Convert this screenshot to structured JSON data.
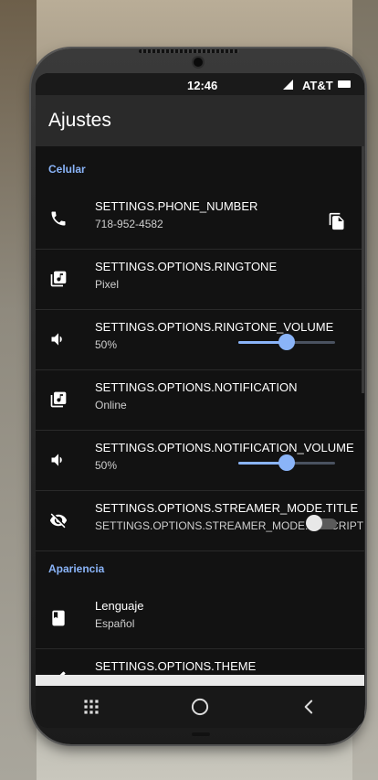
{
  "status_bar": {
    "time": "12:46",
    "carrier": "AT&T"
  },
  "app_bar": {
    "title": "Ajustes"
  },
  "sections": [
    {
      "label": "Celular"
    },
    {
      "label": "Apariencia"
    }
  ],
  "rows": {
    "phone": {
      "title": "SETTINGS.PHONE_NUMBER",
      "value": "718-952-4582",
      "icon": "phone-icon",
      "action_icon": "copy-icon"
    },
    "ringtone": {
      "title": "SETTINGS.OPTIONS.RINGTONE",
      "value": "Pixel",
      "icon": "music-note-icon"
    },
    "ringtone_volume": {
      "title": "SETTINGS.OPTIONS.RINGTONE_VOLUME",
      "value": "50%",
      "icon": "speaker-icon",
      "level": 0.5
    },
    "notification": {
      "title": "SETTINGS.OPTIONS.NOTIFICATION",
      "value": "Online",
      "icon": "music-note-icon"
    },
    "notification_volume": {
      "title": "SETTINGS.OPTIONS.NOTIFICATION_VOLUME",
      "value": "50%",
      "icon": "speaker-icon",
      "level": 0.5
    },
    "streamer_mode": {
      "title": "SETTINGS.OPTIONS.STREAMER_MODE.TITLE",
      "value": "SETTINGS.OPTIONS.STREAMER_MODE.DESCRIPTION",
      "icon": "eye-off-icon",
      "enabled": false
    },
    "language": {
      "title": "Lenguaje",
      "value": "Español",
      "icon": "book-icon"
    },
    "theme": {
      "title": "SETTINGS.OPTIONS.THEME",
      "icon": "brush-icon"
    }
  },
  "nav_bar": {
    "icons": [
      "recent-apps-icon",
      "home-icon",
      "back-icon"
    ]
  },
  "colors": {
    "accent": "#8ab4f8",
    "background": "#121212",
    "app_bar": "#2a2a2a"
  }
}
